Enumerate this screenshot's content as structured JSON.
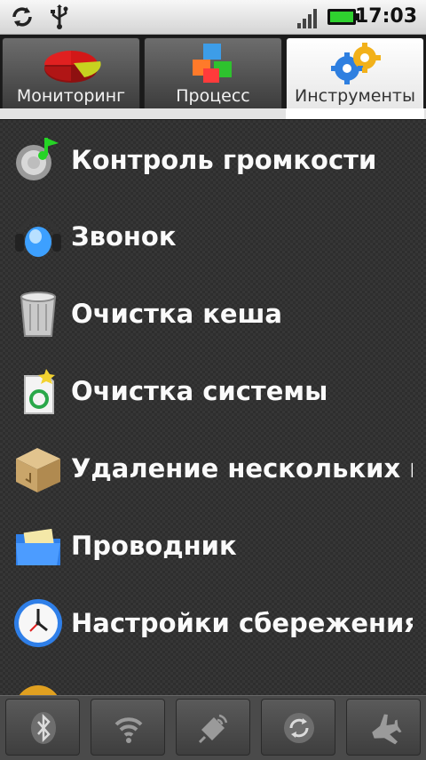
{
  "status_bar": {
    "time": "17:03",
    "icons": [
      "sync-icon",
      "usb-icon",
      "signal-icon",
      "battery-icon"
    ]
  },
  "tabs": [
    {
      "label": "Мониторинг",
      "icon": "pie-chart-icon",
      "active": false
    },
    {
      "label": "Процесс",
      "icon": "cubes-icon",
      "active": false
    },
    {
      "label": "Инструменты",
      "icon": "gears-icon",
      "active": true
    }
  ],
  "tools": [
    {
      "label": "Контроль громкости",
      "icon": "speaker-note-icon"
    },
    {
      "label": "Звонок",
      "icon": "headphones-icon"
    },
    {
      "label": "Очистка кеша",
      "icon": "trash-bin-icon"
    },
    {
      "label": "Очистка системы",
      "icon": "recycle-icon"
    },
    {
      "label": "Удаление нескольких программ",
      "icon": "package-box-icon"
    },
    {
      "label": "Проводник",
      "icon": "folder-icon"
    },
    {
      "label": "Настройки сбережения батареи",
      "icon": "clock-icon"
    }
  ],
  "quick_toggles": [
    {
      "name": "bluetooth-icon"
    },
    {
      "name": "wifi-icon"
    },
    {
      "name": "gps-icon"
    },
    {
      "name": "sync-icon"
    },
    {
      "name": "airplane-icon"
    }
  ],
  "colors": {
    "accent_tab": "#ffffff",
    "list_bg": "#2e2e2e",
    "bar_bg": "#4a4a4a"
  }
}
